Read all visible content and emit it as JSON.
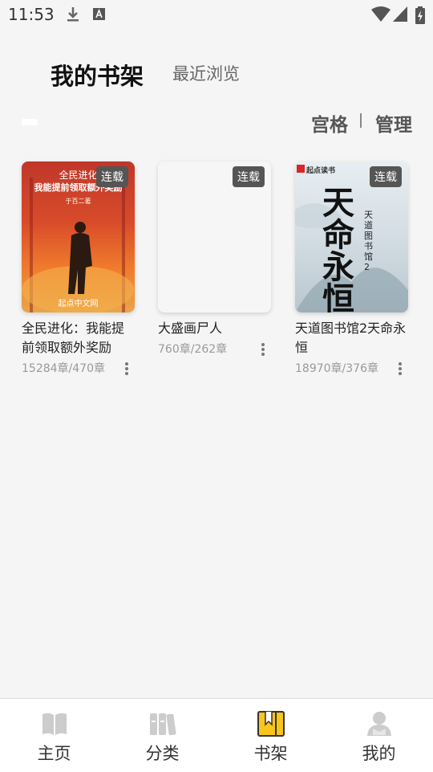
{
  "status": {
    "time": "11:53"
  },
  "header": {
    "tab_shelf": "我的书架",
    "tab_recent": "最近浏览"
  },
  "toolbar": {
    "grid_label": "宫格",
    "manage_label": "管理"
  },
  "books": [
    {
      "title": "全民进化：我能提前领取额外奖励",
      "meta": "15284章/470章",
      "badge": "连载",
      "cover_text": {
        "series": "全民进化",
        "headline": "我能提前领取额外奖励",
        "author": "于百二著",
        "publisher": "起点中文网"
      }
    },
    {
      "title": "大盛画尸人",
      "meta": "760章/262章",
      "badge": "连载"
    },
    {
      "title": "天道图书馆2天命永恒",
      "meta": "18970章/376章",
      "badge": "连载",
      "cover_text": {
        "publisher": "起点读书",
        "headline": "天命永恒",
        "series": "天道图书馆2"
      }
    }
  ],
  "bottom_nav": {
    "home": "主页",
    "category": "分类",
    "shelf": "书架",
    "mine": "我的"
  },
  "colors": {
    "accent": "#f7c51c",
    "badge_bg": "#555555",
    "background": "#f5f5f5"
  }
}
